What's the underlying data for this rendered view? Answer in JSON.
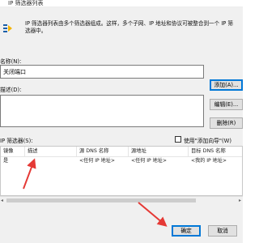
{
  "window": {
    "title": "IP 筛选器列表"
  },
  "description": "IP 筛选器列表由多个筛选器组成。这样，多个子网、IP 地址和协议可被整合到一个 IP 筛选器中。",
  "name_field": {
    "label": "名称(N):",
    "value": "关闭端口"
  },
  "desc_field": {
    "label": "描述(D):",
    "value": ""
  },
  "buttons": {
    "add": "添加(A)...",
    "edit": "编辑(E)...",
    "remove": "删除(R)",
    "ok": "确定",
    "cancel": "取消"
  },
  "filters_label": "IP 筛选器(S):",
  "wizard_checkbox": {
    "label": "使用\"添加向导\"(W)",
    "checked": false
  },
  "table": {
    "columns": [
      "镜像",
      "描述",
      "源 DNS 名称",
      "源地址",
      "目标 DNS 名称"
    ],
    "rows": [
      [
        "是",
        "",
        "<任何 IP 地址>",
        "<任何 IP 地址>",
        "<我的 IP 地址>"
      ]
    ]
  },
  "colors": {
    "accent": "#0078d7",
    "annotation_arrow": "#e53935"
  }
}
